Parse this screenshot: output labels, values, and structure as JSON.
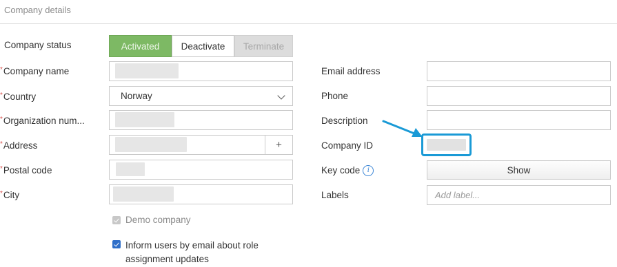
{
  "section_title": "Company details",
  "status": {
    "label": "Company status",
    "options": {
      "activated": "Activated",
      "deactivate": "Deactivate",
      "terminate": "Terminate"
    }
  },
  "left": {
    "company_name": "Company name",
    "country": "Country",
    "country_value": "Norway",
    "org_number": "Organization num...",
    "address": "Address",
    "address_add": "+",
    "postal_code": "Postal code",
    "city": "City",
    "required_mark": "*"
  },
  "right": {
    "email": "Email address",
    "phone": "Phone",
    "description": "Description",
    "company_id": "Company ID",
    "key_code": "Key code",
    "key_code_info": "i",
    "show_button": "Show",
    "labels": "Labels",
    "labels_placeholder": "Add label..."
  },
  "options": {
    "demo_company": "Demo company",
    "inform_line1": "Inform users by email about role",
    "inform_line2": "assignment updates"
  },
  "colors": {
    "accent": "#7db964",
    "highlight": "#1a9ad6",
    "required": "#d9534f"
  }
}
